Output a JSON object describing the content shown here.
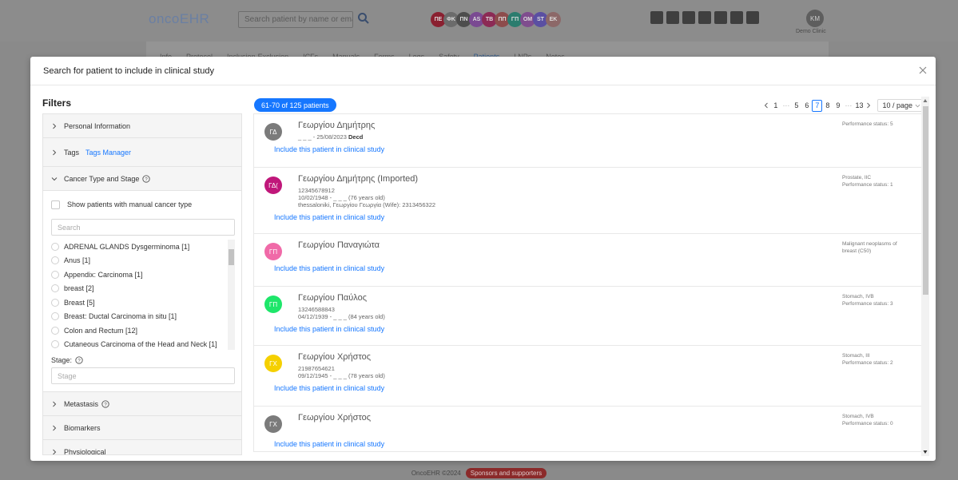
{
  "background": {
    "logo": "oncoEHR",
    "search_placeholder": "Search patient by name or email",
    "badges": [
      {
        "label": "ΠΕ",
        "color": "#8a2030"
      },
      {
        "label": "ΦΚ",
        "color": "#6b6b6b"
      },
      {
        "label": "ΠΝ",
        "color": "#4d4d4d"
      },
      {
        "label": "AS",
        "color": "#7a4a92"
      },
      {
        "label": "ΤΒ",
        "color": "#8c2a55"
      },
      {
        "label": "ΠΠ",
        "color": "#8d4c4c"
      },
      {
        "label": "ΓΠ",
        "color": "#2b7c6e"
      },
      {
        "label": "ΟΜ",
        "color": "#7f4d8e"
      },
      {
        "label": "ST",
        "color": "#5a4fa2"
      },
      {
        "label": "ΕΚ",
        "color": "#8c6868"
      }
    ],
    "user_initials": "KM",
    "clinic": "Demo Clinic",
    "tabs": [
      "Info",
      "Protocol",
      "Inclusion-Exclusion",
      "ICFs",
      "Manuals",
      "Forms",
      "Logs",
      "Safety",
      "Patients",
      "LNPs",
      "Notes"
    ],
    "active_tab": "Patients",
    "footer_text": "OncoEHR ©2024",
    "footer_sponsors": "Sponsors and supporters"
  },
  "modal": {
    "title": "Search for patient to include in clinical study"
  },
  "filters": {
    "title": "Filters",
    "personal_information": "Personal Information",
    "tags": "Tags",
    "tags_manager": "Tags Manager",
    "cancer_type_stage": "Cancer Type and Stage",
    "manual_cancer_label": "Show patients with manual cancer type",
    "search_placeholder": "Search",
    "cancer_types": [
      {
        "label": "ADRENAL GLANDS Dysgerminoma [1]"
      },
      {
        "label": "Anus [1]"
      },
      {
        "label": "Appendix: Carcinoma [1]"
      },
      {
        "label": "breast [2]"
      },
      {
        "label": "Breast [5]"
      },
      {
        "label": "Breast: Ductal Carcinoma in situ [1]"
      },
      {
        "label": "Colon and Rectum [12]"
      },
      {
        "label": "Cutaneous Carcinoma of the Head and Neck [1]"
      }
    ],
    "stage_label": "Stage:",
    "stage_placeholder": "Stage",
    "metastasis": "Metastasis",
    "biomarkers": "Biomarkers",
    "physiological": "Physiological"
  },
  "results": {
    "count_label": "61-70 of 125 patients",
    "pages": [
      "1",
      "5",
      "6",
      "7",
      "8",
      "9",
      "13"
    ],
    "active_page": "7",
    "page_size": "10 / page",
    "include_link": "Include this patient in clinical study",
    "patients": [
      {
        "initials": "ΓΔ",
        "avatar_color": "#7b7b7b",
        "name": "Γεωργίου Δημήτρης",
        "line1": "_ _ _ - 25/08/2023",
        "line1_bold": "Decd",
        "line2": "",
        "line3": "",
        "right1": "Performance status: 5",
        "right2": ""
      },
      {
        "initials": "ΓΔ(",
        "avatar_color": "#c0177a",
        "name": "Γεωργίου Δημήτρης (Imported)",
        "line1": "12345678912",
        "line1_bold": "",
        "line2": "10/02/1948 - _ _ _ (76 years old)",
        "line3": "thessaloniki,   Γεωργίου Γεωργία (Wife): 2313456322",
        "right1": "Prostate, IIC",
        "right2": "Performance status: 1"
      },
      {
        "initials": "ΓΠ",
        "avatar_color": "#f06aa8",
        "name": "Γεωργίου Παναγιώτα",
        "line1": "",
        "line1_bold": "",
        "line2": "",
        "line3": "",
        "right1": "Malignant neoplasms of",
        "right2": "breast (C50)"
      },
      {
        "initials": "ΓΠ",
        "avatar_color": "#1ee66a",
        "name": "Γεωργίου Παύλος",
        "line1": "13246588843",
        "line1_bold": "",
        "line2": "04/12/1939 - _ _ _ (84 years old)",
        "line3": "",
        "right1": "Stomach, IVB",
        "right2": "Performance status: 3"
      },
      {
        "initials": "ΓΧ",
        "avatar_color": "#f5d000",
        "name": "Γεωργίου Χρήστος",
        "line1": "21987654621",
        "line1_bold": "",
        "line2": "09/12/1945 - _ _ _ (78 years old)",
        "line3": "",
        "right1": "Stomach, III",
        "right2": "Performance status: 2"
      },
      {
        "initials": "ΓΧ",
        "avatar_color": "#7b7b7b",
        "name": "Γεωργίου Χρήστος",
        "line1": "",
        "line1_bold": "",
        "line2": "",
        "line3": "",
        "right1": "Stomach, IVB",
        "right2": "Performance status: 0"
      }
    ]
  }
}
